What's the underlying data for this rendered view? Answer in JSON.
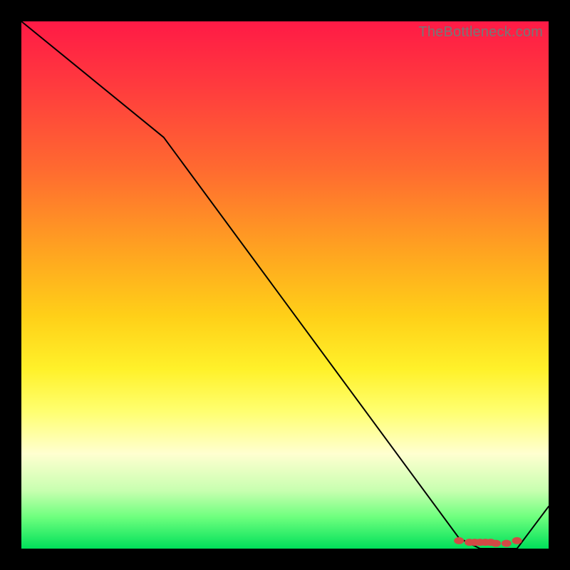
{
  "watermark": "TheBottleneck.com",
  "chart_data": {
    "type": "line",
    "x": [
      0.0,
      0.27,
      0.83,
      0.87,
      0.94,
      1.0
    ],
    "values": [
      1.0,
      0.78,
      0.02,
      0.0,
      0.0,
      0.08
    ],
    "xlabel": "",
    "ylabel": "",
    "xlim": [
      0,
      1
    ],
    "ylim": [
      0,
      1
    ],
    "markers": [
      {
        "x": 0.83,
        "y": 0.015
      },
      {
        "x": 0.85,
        "y": 0.012
      },
      {
        "x": 0.86,
        "y": 0.012
      },
      {
        "x": 0.87,
        "y": 0.012
      },
      {
        "x": 0.88,
        "y": 0.012
      },
      {
        "x": 0.89,
        "y": 0.012
      },
      {
        "x": 0.9,
        "y": 0.01
      },
      {
        "x": 0.92,
        "y": 0.01
      },
      {
        "x": 0.94,
        "y": 0.015
      }
    ],
    "title": "",
    "gradient": {
      "top": "#ff1a46",
      "mid": "#ffd018",
      "bottom": "#00e05a"
    },
    "marker_color": "#d24a45",
    "line_color": "#000000"
  }
}
